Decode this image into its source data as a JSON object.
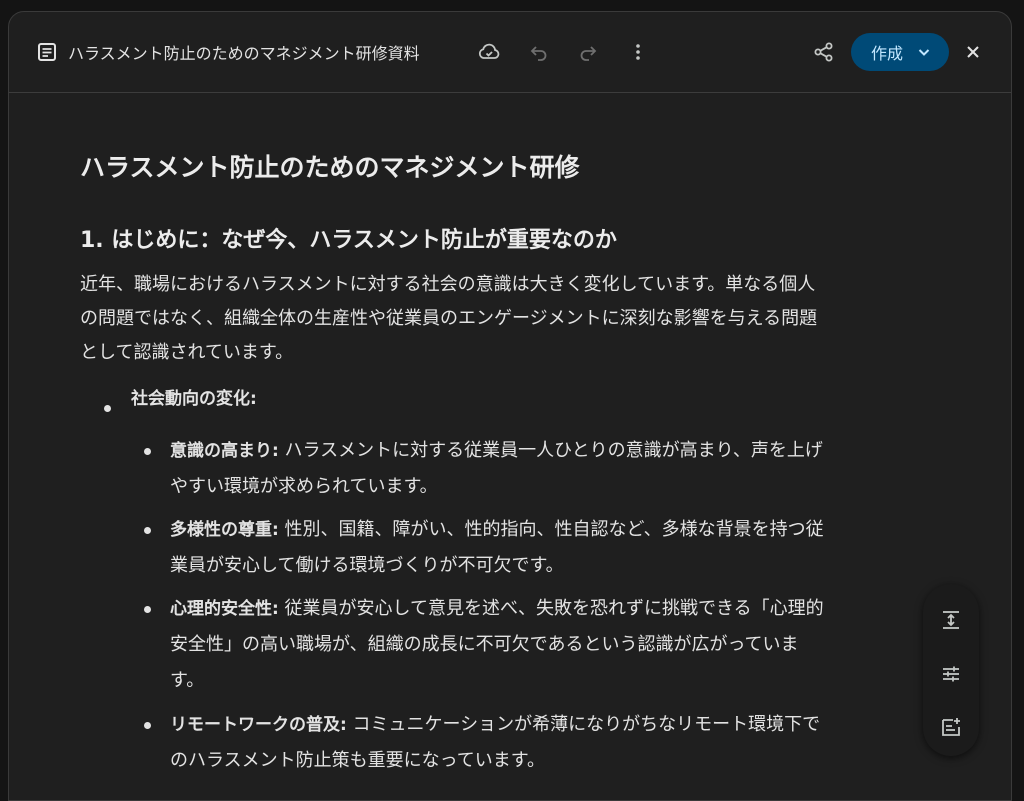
{
  "header": {
    "title": "ハラスメント防止のためのマネジメント研修資料",
    "create_label": "作成",
    "icons": [
      "document-icon",
      "cloud-sync-icon",
      "undo-icon",
      "redo-icon",
      "more-vert-icon",
      "share-icon",
      "chevron-down-icon",
      "close-icon"
    ]
  },
  "document": {
    "title": "ハラスメント防止のためのマネジメント研修",
    "section_heading": "1. はじめに：なぜ今、ハラスメント防止が重要なのか",
    "intro_lines": [
      "近年、職場におけるハラスメントに対する社会の意識は大きく変化しています。単なる個人",
      "の問題ではなく、組織全体の生産性や従業員のエンゲージメントに深刻な影響を与える問題",
      "として認識されています。"
    ],
    "bullet_l1": "社会動向の変化:",
    "items": [
      {
        "label": "意識の高まり:",
        "lines": [
          " ハラスメントに対する従業員一人ひとりの意識が高まり、声を上げ",
          "やすい環境が求められています。"
        ]
      },
      {
        "label": "多様性の尊重:",
        "lines": [
          " 性別、国籍、障がい、性的指向、性自認など、多様な背景を持つ従",
          "業員が安心して働ける環境づくりが不可欠です。"
        ]
      },
      {
        "label": "心理的安全性:",
        "lines": [
          " 従業員が安心して意見を述べ、失敗を恐れずに挑戦できる「心理的",
          "安全性」の高い職場が、組織の成長に不可欠であるという認識が広がっていま",
          "す。"
        ]
      },
      {
        "label": "リモートワークの普及:",
        "lines": [
          " コミュニケーションが希薄になりがちなリモート環境下で",
          "のハラスメント防止策も重要になっています。"
        ]
      }
    ]
  },
  "side_panel": {
    "icons": [
      "vertical-align-icon",
      "tune-icon",
      "add-note-icon"
    ]
  },
  "colors": {
    "background": "#1f1f1f",
    "accent_button": "#004a77",
    "accent_text": "#c2e7ff",
    "text": "#e3e3e3"
  }
}
